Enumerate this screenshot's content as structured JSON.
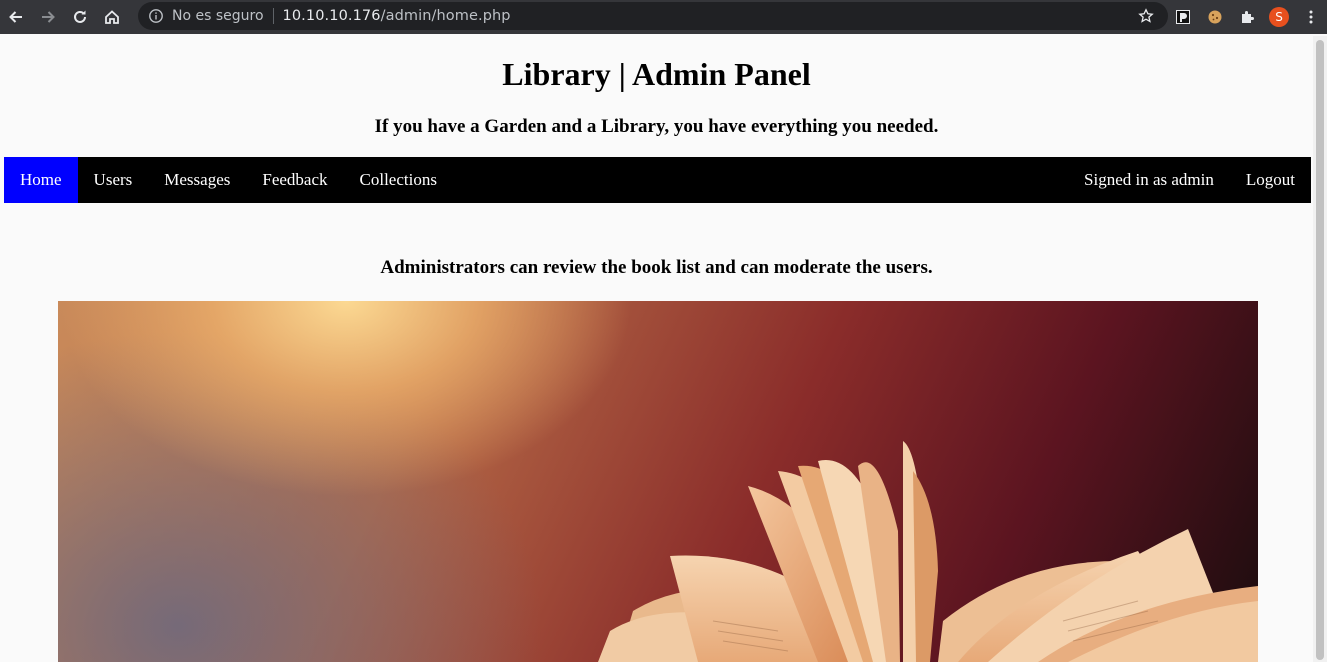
{
  "browser": {
    "security_label": "No es seguro",
    "url_host": "10.10.10.176",
    "url_path": "/admin/home.php",
    "profile_initial": "S",
    "profile_color": "#e8501e"
  },
  "header": {
    "title": "Library | Admin Panel",
    "subtitle": "If you have a Garden and a Library, you have everything you needed."
  },
  "navbar": {
    "items": [
      {
        "label": "Home",
        "active": true
      },
      {
        "label": "Users"
      },
      {
        "label": "Messages"
      },
      {
        "label": "Feedback"
      },
      {
        "label": "Collections"
      }
    ],
    "signed_in": "Signed in as admin",
    "logout": "Logout",
    "active_color": "#0000ff"
  },
  "main": {
    "lead": "Administrators can review the book list and can moderate the users."
  }
}
